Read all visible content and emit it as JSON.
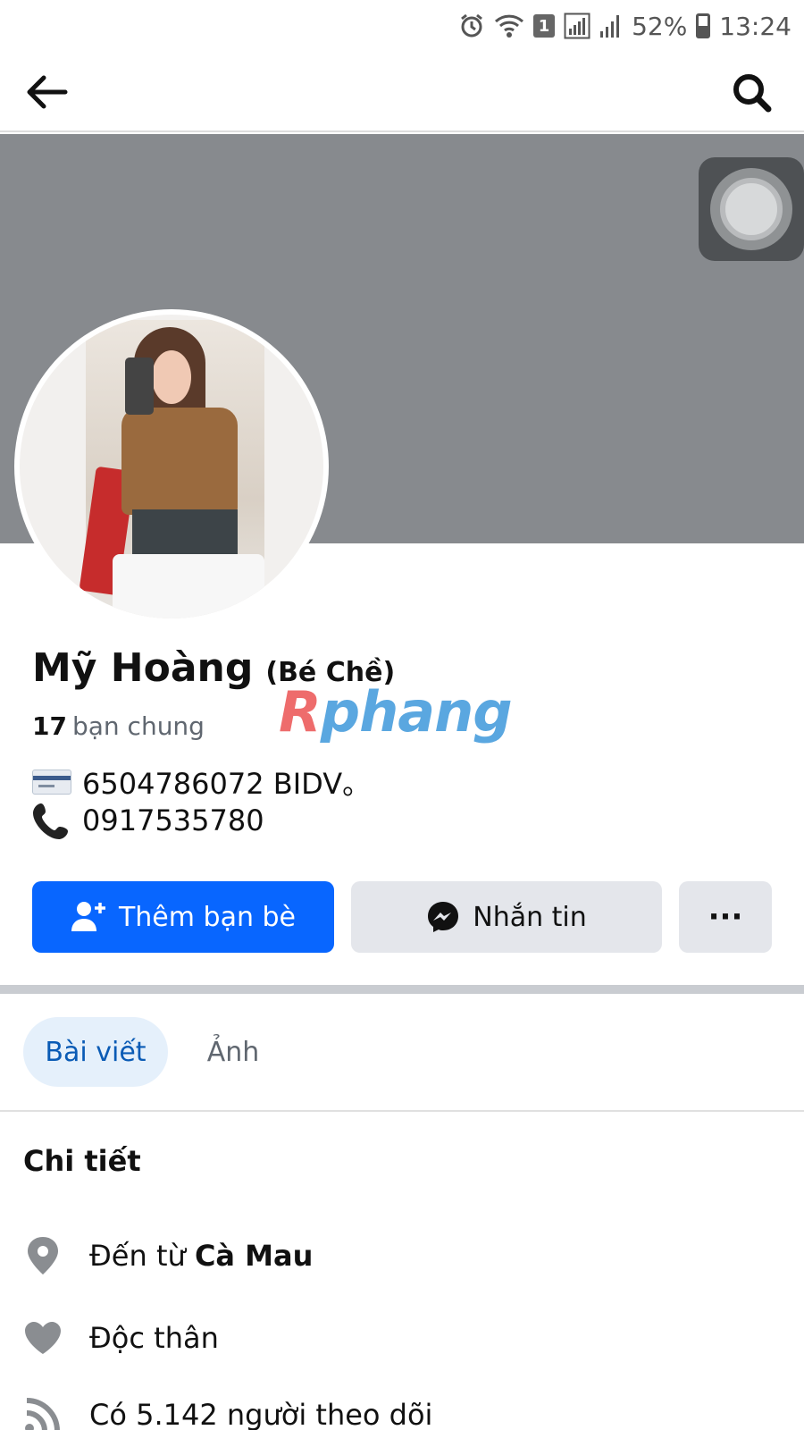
{
  "status_bar": {
    "battery": "52%",
    "time": "13:24",
    "sim_badge": "1"
  },
  "profile": {
    "name": "Mỹ Hoàng",
    "nickname": "(Bé Chề)",
    "mutual_count": "17",
    "mutual_label": "bạn chung",
    "bank_line": "6504786072 BIDV。",
    "phone_line": "0917535780"
  },
  "watermark": {
    "first": "R",
    "rest": "phang"
  },
  "actions": {
    "add_friend": "Thêm bạn bè",
    "message": "Nhắn tin",
    "more": "···"
  },
  "tabs": [
    {
      "label": "Bài viết",
      "active": true
    },
    {
      "label": "Ảnh",
      "active": false
    }
  ],
  "details": {
    "title": "Chi tiết",
    "from_prefix": "Đến từ",
    "from_place": "Cà Mau",
    "relationship": "Độc thân",
    "followers": "Có 5.142 người theo dõi"
  },
  "icons": {
    "back": "arrow-left-icon",
    "search": "search-icon",
    "add_friend": "user-plus-icon",
    "message": "messenger-icon",
    "location": "location-pin-icon",
    "relationship": "heart-icon",
    "followers": "rss-feed-icon"
  },
  "colors": {
    "primary": "#0866ff",
    "secondary_button": "#e4e6eb",
    "cover": "#878a8e",
    "active_tab_bg": "#e5f0fb",
    "active_tab_text": "#0a5bb5"
  }
}
